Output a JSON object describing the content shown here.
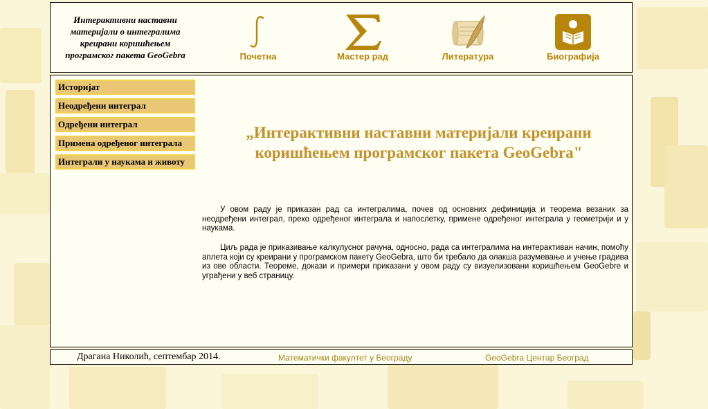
{
  "header": {
    "site_title": "Интерактивни наставни материјали о интегралима креирани коришћењем програмског пакета GeoGebra",
    "nav": [
      {
        "label": "Почетна",
        "icon": "integral-icon"
      },
      {
        "label": "Мастер рад",
        "icon": "sigma-icon"
      },
      {
        "label": "Литература",
        "icon": "scroll-quill-icon"
      },
      {
        "label": "Биографија",
        "icon": "reader-icon"
      }
    ]
  },
  "sidebar": {
    "items": [
      {
        "label": "Историјат"
      },
      {
        "label": "Неодређени интеграл"
      },
      {
        "label": "Одређени интеграл"
      },
      {
        "label": "Примена одређеног интеграла"
      },
      {
        "label": "Интеграли у наукама и животу"
      }
    ]
  },
  "main": {
    "headline": "„Интерактивни наставни материјали креирани коришћењем програмског пакета GeoGebra\"",
    "paragraphs": [
      "У овом раду је приказан рад са интегралима, почев од основних дефиниција и теорема везаних за неодређени интеграл, преко одређеног интеграла и напослетку, примене одређеног интеграла у геометрији и у наукама.",
      "Циљ рада је приказивање калкулусног рачуна, односно, рада са интегралима на интерактиван начин, помоћу аплета који су креирани у програмском пакету GeoGebra, што би требало да олакша разумевање и учење градива из ове области. Теореме, докази и примери приказани у овом раду су визуелизовани коришћењем GeoGebre и уграђени у веб страницу."
    ]
  },
  "footer": {
    "author": "Драгана Николић, септембар 2014.",
    "link1": "Математички факултет у Београду",
    "link2": "GeoGebra Центар Београд"
  },
  "colors": {
    "accent": "#c1912b",
    "sidebar_bg": "#e9c774",
    "page_bg": "#fbf6d9"
  }
}
